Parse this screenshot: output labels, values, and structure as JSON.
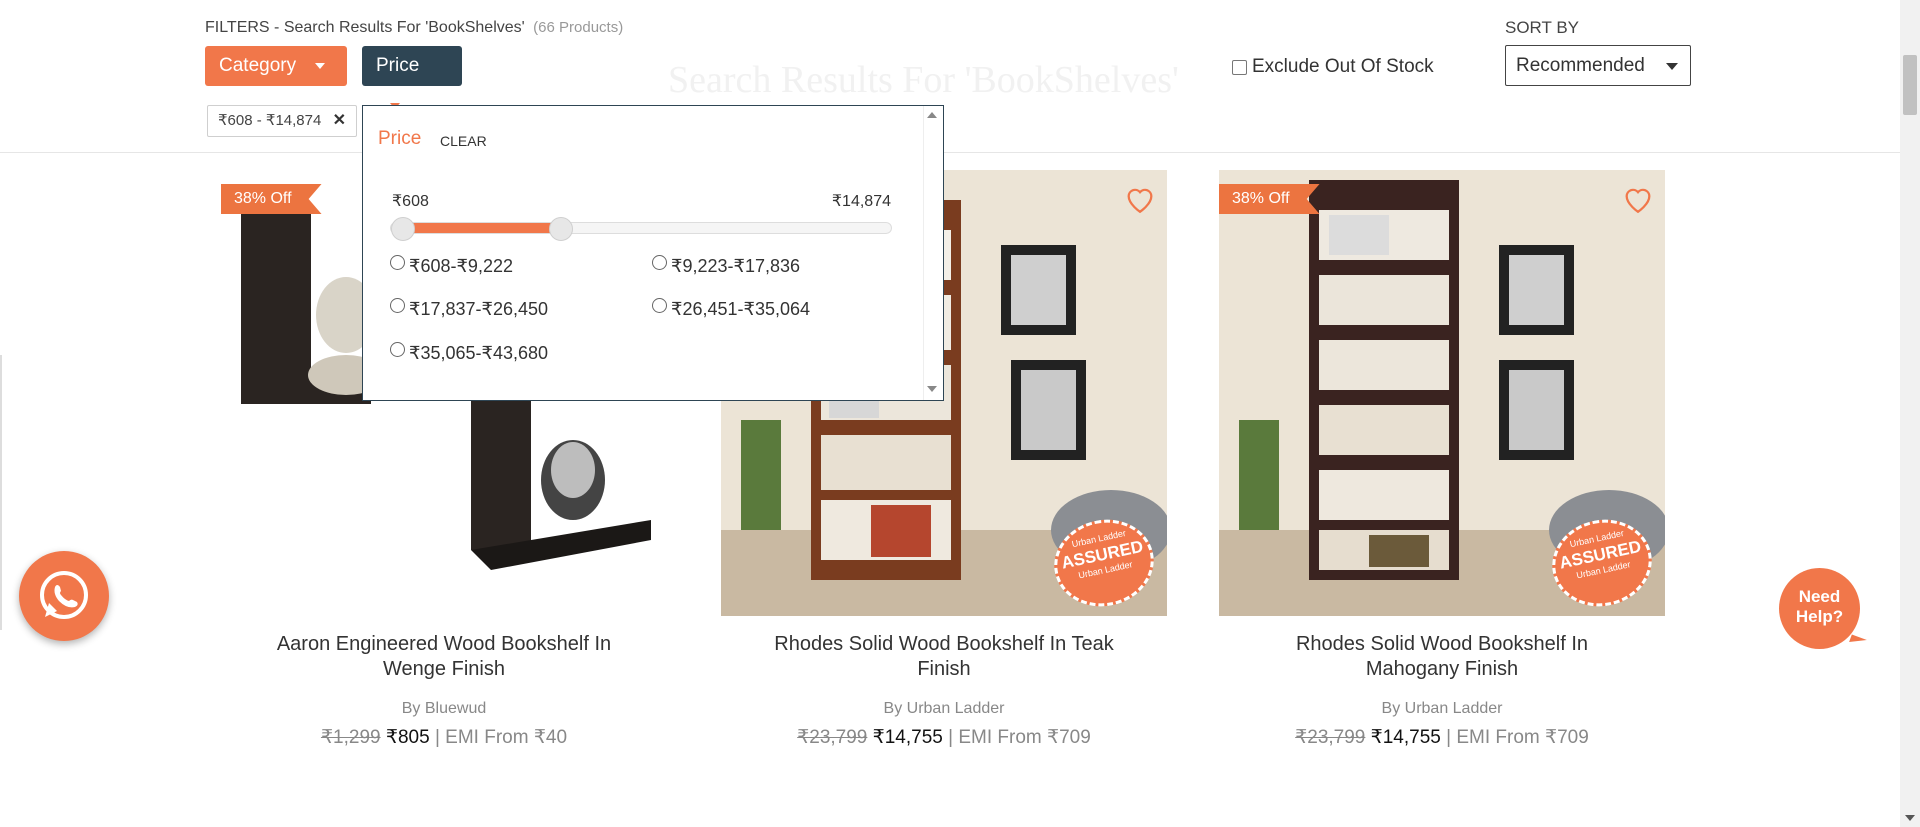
{
  "filters": {
    "title": "FILTERS - Search Results For 'BookShelves'",
    "count": "(66 Products)",
    "category_label": "Category",
    "price_label": "Price",
    "applied_chip": "₹608 - ₹14,874",
    "ghost_title": "Search Results For 'BookShelves'"
  },
  "exclude_out_of_stock": {
    "label": "Exclude Out Of Stock",
    "checked": false
  },
  "sort": {
    "label": "SORT BY",
    "value": "Recommended"
  },
  "price_dropdown": {
    "title": "Price",
    "clear_label": "CLEAR",
    "min_label": "₹608",
    "max_label": "₹14,874",
    "slider": {
      "min": 608,
      "max": 43680,
      "low": 608,
      "high": 14874
    },
    "options": [
      "₹608-₹9,222",
      "₹9,223-₹17,836",
      "₹17,837-₹26,450",
      "₹26,451-₹35,064",
      "₹35,065-₹43,680"
    ]
  },
  "products": [
    {
      "badge": "38% Off",
      "title": "Aaron Engineered Wood Bookshelf In Wenge Finish",
      "brand": "By Bluewud",
      "old_price": "₹1,299",
      "new_price": "₹805",
      "emi": "| EMI From ₹40"
    },
    {
      "badge": "",
      "title": "Rhodes Solid Wood Bookshelf In Teak Finish",
      "brand": "By Urban Ladder",
      "old_price": "₹23,799",
      "new_price": "₹14,755",
      "emi": "| EMI From ₹709",
      "stamp": [
        "Urban Ladder",
        "ASSURED",
        "Urban Ladder"
      ]
    },
    {
      "badge": "38% Off",
      "title": "Rhodes Solid Wood Bookshelf In Mahogany Finish",
      "brand": "By Urban Ladder",
      "old_price": "₹23,799",
      "new_price": "₹14,755",
      "emi": "| EMI From ₹709",
      "stamp": [
        "Urban Ladder",
        "ASSURED",
        "Urban Ladder"
      ]
    }
  ],
  "help": {
    "line1": "Need",
    "line2": "Help?"
  },
  "colors": {
    "accent": "#f1774a",
    "dark": "#2e4554"
  },
  "icons": [
    "caret-down-icon",
    "close-icon",
    "heart-icon",
    "whatsapp-icon",
    "scroll-arrow-icon"
  ]
}
